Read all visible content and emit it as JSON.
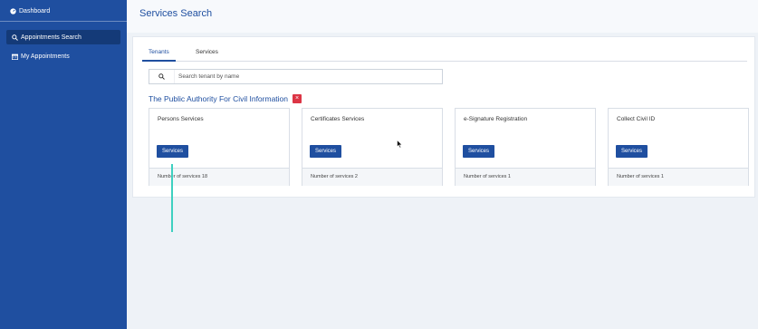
{
  "sidebar": {
    "dashboard": "Dashboard",
    "items": [
      {
        "label": "Appointments Search",
        "icon": "search-icon",
        "active": true
      },
      {
        "label": "My Appointments",
        "icon": "calendar-icon",
        "active": false
      }
    ]
  },
  "header": {
    "title": "Services Search"
  },
  "tabs": [
    "Tenants",
    "Services"
  ],
  "search": {
    "placeholder": "Search tenant by name",
    "value": ""
  },
  "authority": {
    "title": "The Public Authority For Civil Information",
    "remove": "×"
  },
  "cards": [
    {
      "name": "Persons Services",
      "button": "Services",
      "count": "Number of services 18"
    },
    {
      "name": "Certificates Services",
      "button": "Services",
      "count": "Number of services 2"
    },
    {
      "name": "e-Signature Registration",
      "button": "Services",
      "count": "Number of services 1"
    },
    {
      "name": "Collect Civil ID",
      "button": "Services",
      "count": "Number of services 1"
    }
  ],
  "colors": {
    "primary": "#1f4fa0",
    "sidebar": "#1f4fa0",
    "danger": "#dc3545",
    "annotation": "#3ed0c0"
  }
}
